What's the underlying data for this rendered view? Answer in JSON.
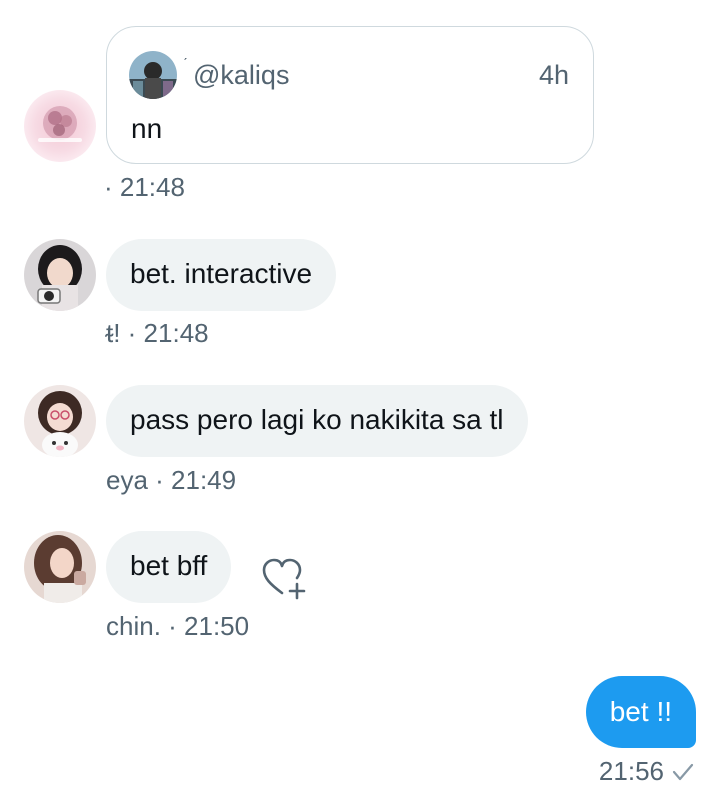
{
  "messages": [
    {
      "id": "m1",
      "quote": {
        "handle": "@kaliqs",
        "time": "4h",
        "text": "nn",
        "avatar_icon": "profile-photo-icon"
      },
      "meta": "· 21:48",
      "avatar_icon": "pink-flower-avatar-icon"
    },
    {
      "id": "m2",
      "text": "bet. interactive",
      "meta": "ᵵ! · 21:48",
      "avatar_icon": "girl-with-camera-avatar-icon"
    },
    {
      "id": "m3",
      "text": "pass pero lagi ko nakikita sa tl",
      "meta": "eya · 21:49",
      "avatar_icon": "girl-with-plush-avatar-icon"
    },
    {
      "id": "m4",
      "text": "bet bff",
      "meta": "chin. · 21:50",
      "avatar_icon": "girl-portrait-avatar-icon",
      "reaction_icon": "add-reaction-heart-icon"
    }
  ],
  "sent": {
    "text": "bet !!",
    "time": "21:56",
    "status_icon": "checkmark-icon"
  },
  "colors": {
    "accent": "#1d9bf0",
    "bubble_bg": "#eff3f4",
    "muted_text": "#536471",
    "border": "#cfd9de"
  }
}
